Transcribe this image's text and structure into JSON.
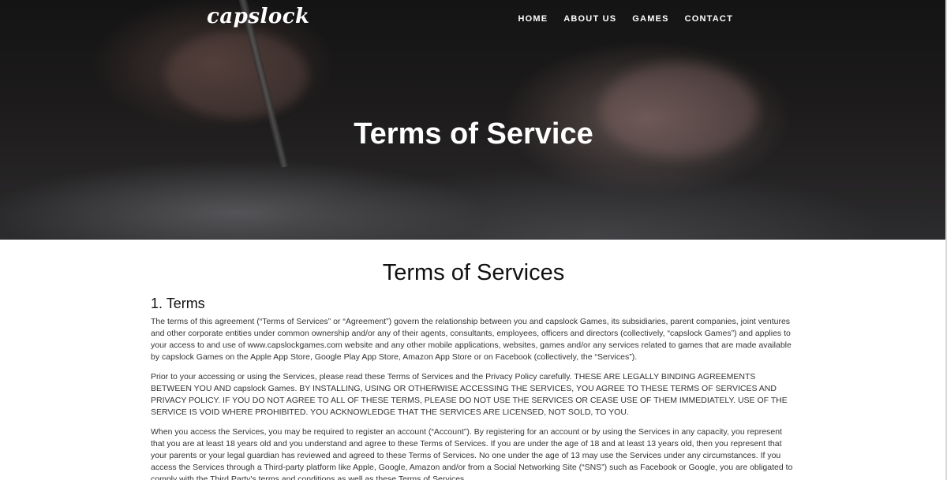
{
  "header": {
    "logo": "capslock",
    "nav": [
      "HOME",
      "ABOUT US",
      "GAMES",
      "CONTACT"
    ],
    "hero_title": "Terms of Service"
  },
  "main": {
    "page_heading": "Terms of Services",
    "section_heading": "1. Terms",
    "paragraphs": [
      "The terms of this agreement (“Terms of Services” or “Agreement”) govern the relationship between you and capslock Games, its subsidiaries, parent companies, joint ventures and other corporate entities under common ownership and/or any of their agents, consultants, employees, officers and directors (collectively, “capslock Games”) and applies to your access to and use of www.capslockgames.com website and any other mobile applications, websites, games and/or any services related to games that are made available by capslock Games on the Apple App Store, Google Play App Store, Amazon App Store or on Facebook (collectively, the “Services”).",
      "Prior to your accessing or using the Services, please read these Terms of Services and the Privacy Policy carefully. THESE ARE LEGALLY BINDING AGREEMENTS BETWEEN YOU AND capslock Games. BY INSTALLING, USING OR OTHERWISE ACCESSING THE SERVICES, YOU AGREE TO THESE TERMS OF SERVICES AND PRIVACY POLICY. IF YOU DO NOT AGREE TO ALL OF THESE TERMS, PLEASE DO NOT USE THE SERVICES OR CEASE USE OF THEM IMMEDIATELY. USE OF THE SERVICE IS VOID WHERE PROHIBITED. YOU ACKNOWLEDGE THAT THE SERVICES ARE LICENSED, NOT SOLD, TO YOU.",
      "When you access the Services, you may be required to register an account (“Account”). By registering for an account or by using the Services in any capacity, you represent that you are at least 18 years old and you understand and agree to these Terms of Services. If you are under the age of 18 and at least 13 years old, then you represent that your parents or your legal guardian has reviewed and agreed to these Terms of Services. No one under the age of 13 may use the Services under any circumstances. If you access the Services through a Third-party platform like Apple, Google, Amazon and/or from a Social Networking Site (“SNS”) such as Facebook or Google, you are obligated to comply with the Third Party's terms and conditions as well as these Terms of Services."
    ]
  }
}
